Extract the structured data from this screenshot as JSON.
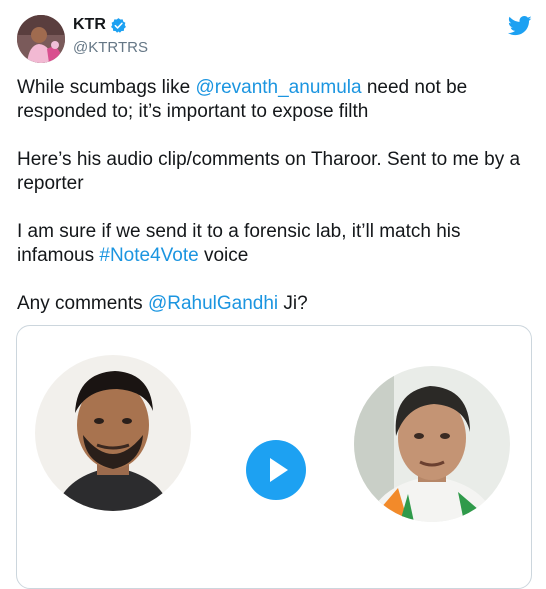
{
  "author": {
    "name": "KTR",
    "handle": "@KTRTRS",
    "verified_icon": "verified-badge-icon",
    "avatar_icon": "profile-photo"
  },
  "platform_icon": "twitter-bird-icon",
  "tweet": {
    "p1_pre": "While scumbags like ",
    "p1_link": "@revanth_anumula",
    "p1_post": " need not be responded to; it’s important to expose filth",
    "p2": "Here’s his audio clip/comments on Tharoor. Sent to me by a reporter",
    "p3_pre": "I am sure if we send it to a forensic lab, it’ll match his infamous ",
    "p3_link": "#Note4Vote",
    "p3_post": " voice",
    "p4_pre": "Any comments ",
    "p4_link": "@RahulGandhi",
    "p4_post": " Ji?"
  },
  "media": {
    "play_icon": "play-icon",
    "left_image": "portrait-left",
    "right_image": "portrait-right"
  },
  "colors": {
    "link": "#1b95e0",
    "accent": "#1da1f2",
    "text": "#14171a",
    "muted": "#657786",
    "border": "#ccd6dd"
  }
}
